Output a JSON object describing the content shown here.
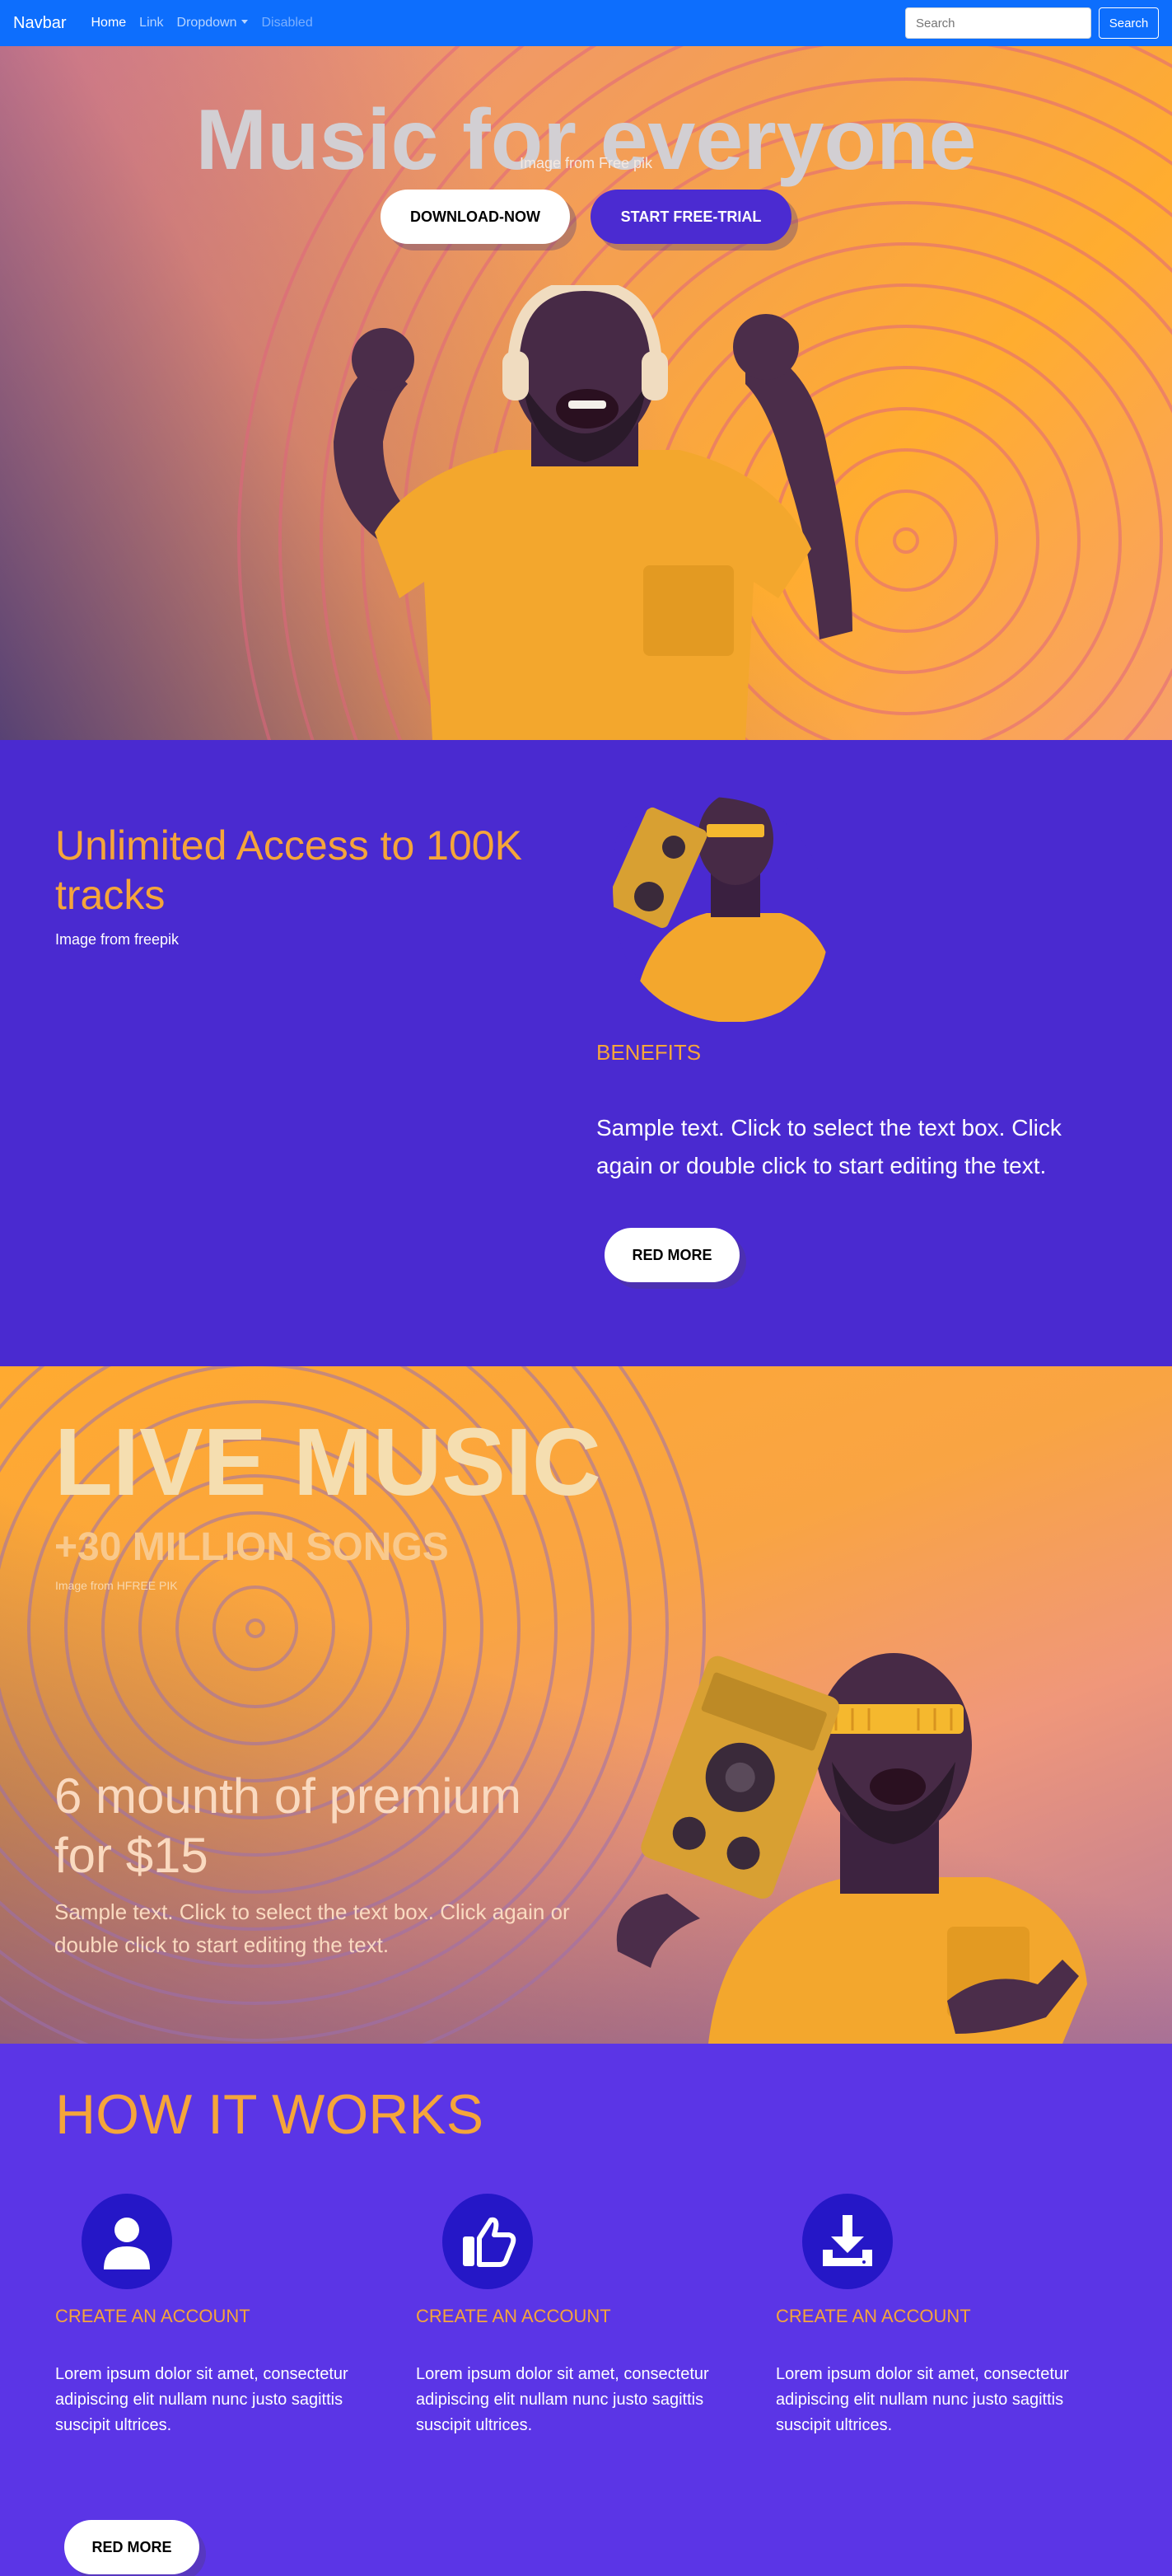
{
  "navbar": {
    "brand": "Navbar",
    "links": [
      "Home",
      "Link",
      "Dropdown",
      "Disabled"
    ],
    "search_placeholder": "Search",
    "search_button": "Search",
    "bg_color": "#0d6efd"
  },
  "hero": {
    "title": "Music for everyone",
    "caption": "Image from Free pik",
    "download_button": "DOWNLOAD-NOW",
    "trial_button": "START FREE-TRIAL"
  },
  "access": {
    "title": "Unlimited Access to 100K tracks",
    "caption": "Image from freepik",
    "benefits_label": "BENEFITS",
    "text": "Sample text. Click to select the text box. Click again or double click to start editing the text.",
    "button": "RED MORE"
  },
  "live": {
    "title": "LIVE MUSIC",
    "subtitle": "+30 MILLION SONGS",
    "caption": "Image from HFREE PIK",
    "promo": "6 mounth of premium for $15",
    "text": "Sample text. Click to select the text box. Click again or double click to start editing the text."
  },
  "how": {
    "title": "HOW IT WORKS",
    "steps": [
      {
        "icon": "user-icon",
        "title": "CREATE AN ACCOUNT",
        "text": "Lorem ipsum dolor sit amet, consectetur adipiscing elit nullam nunc justo sagittis suscipit ultrices."
      },
      {
        "icon": "thumbs-up-icon",
        "title": "CREATE AN ACCOUNT",
        "text": "Lorem ipsum dolor sit amet, consectetur adipiscing elit nullam nunc justo sagittis suscipit ultrices."
      },
      {
        "icon": "download-icon",
        "title": "CREATE AN ACCOUNT",
        "text": "Lorem ipsum dolor sit amet, consectetur adipiscing elit nullam nunc justo sagittis suscipit ultrices."
      }
    ],
    "button": "RED MORE"
  },
  "colors": {
    "accent_orange": "#f5a53a",
    "purple_dark": "#4a2ad0",
    "purple": "#5b35e6",
    "icon_circle": "#2517c7"
  }
}
